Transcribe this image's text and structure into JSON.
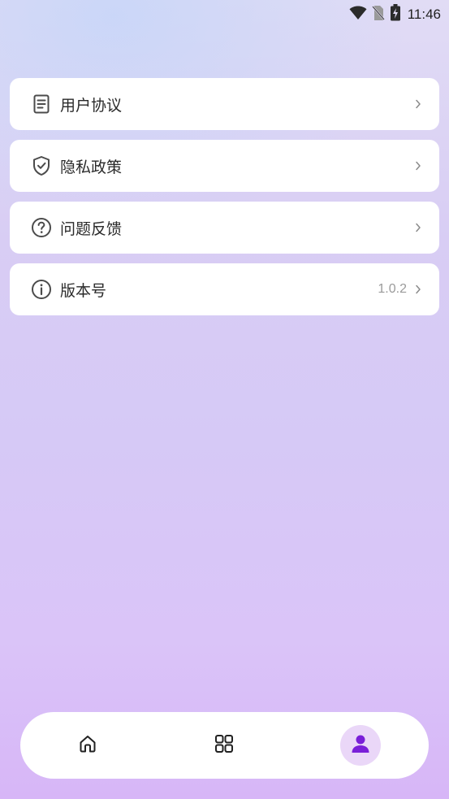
{
  "status_bar": {
    "time": "11:46",
    "icons": [
      "wifi-icon",
      "no-sim-icon",
      "battery-charging-icon"
    ]
  },
  "menu": {
    "items": [
      {
        "label": "用户协议",
        "icon": "document-icon",
        "value": ""
      },
      {
        "label": "隐私政策",
        "icon": "shield-check-icon",
        "value": ""
      },
      {
        "label": "问题反馈",
        "icon": "question-circle-icon",
        "value": ""
      },
      {
        "label": "版本号",
        "icon": "info-circle-icon",
        "value": "1.0.2"
      }
    ]
  },
  "bottom_nav": {
    "items": [
      {
        "icon": "home-icon",
        "active": false
      },
      {
        "icon": "grid-icon",
        "active": false
      },
      {
        "icon": "user-icon",
        "active": true
      }
    ]
  },
  "colors": {
    "accent": "#7a1fd8",
    "active_nav_bg": "#ead7f8",
    "card_bg": "#ffffff",
    "text_primary": "#2a2a2a",
    "text_secondary": "#9a9a9a"
  }
}
